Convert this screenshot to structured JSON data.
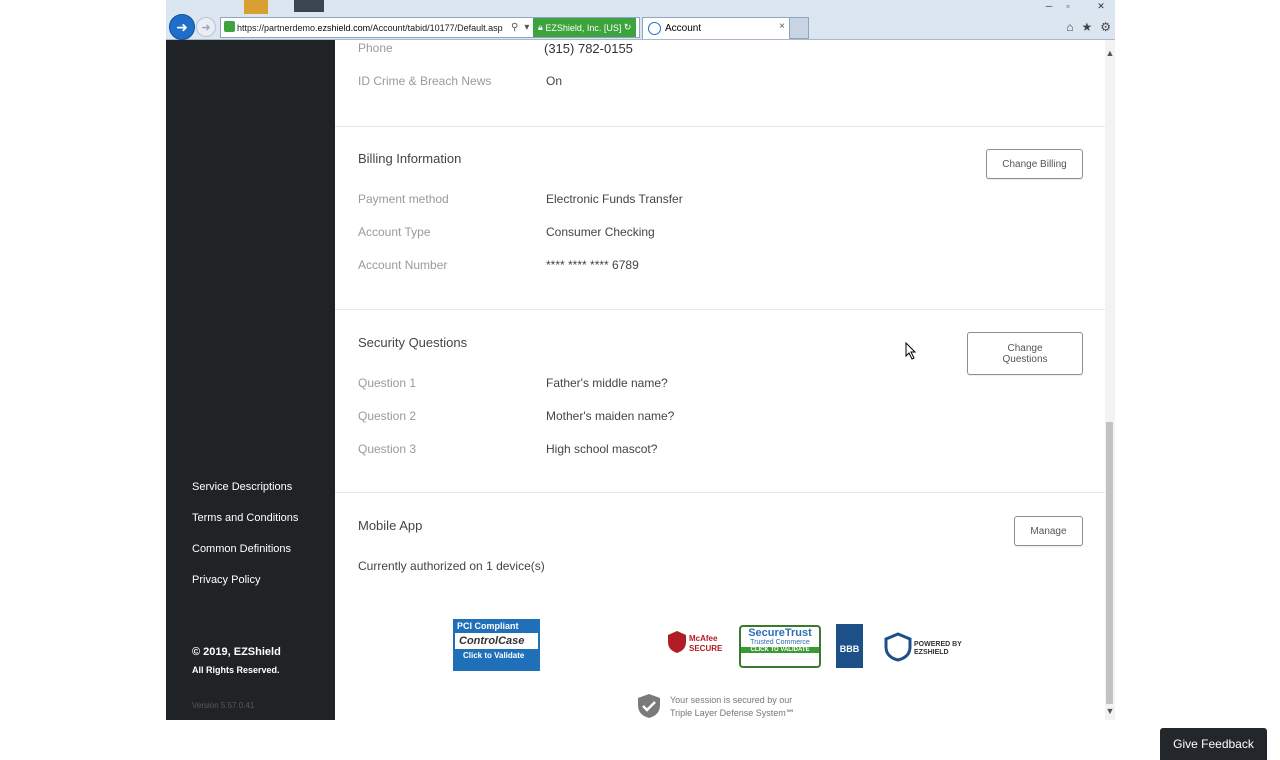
{
  "browser": {
    "url_prefix": "https://partnerdemo.",
    "url_domain": "ezshield.com",
    "url_path": "/Account/tabid/10177/Default.asp",
    "cert": "EZShield, Inc. [US]",
    "tab_title": "Account",
    "tab_close": "×"
  },
  "sidebar": {
    "links": [
      {
        "label": "Service Descriptions"
      },
      {
        "label": "Terms and Conditions"
      },
      {
        "label": "Common Definitions"
      },
      {
        "label": "Privacy Policy"
      }
    ],
    "copyright": "© 2019, EZShield",
    "rights": "All Rights Reserved.",
    "version": "Version 5.57.0.41"
  },
  "contact": {
    "phone_label": "Phone",
    "phone_value": "(315) 782-0155",
    "news_label": "ID Crime & Breach News",
    "news_value": "On"
  },
  "billing": {
    "title": "Billing Information",
    "button": "Change Billing",
    "rows": [
      {
        "label": "Payment method",
        "value": "Electronic Funds Transfer"
      },
      {
        "label": "Account Type",
        "value": "Consumer Checking"
      },
      {
        "label": "Account Number",
        "value": "**** **** **** 6789"
      }
    ]
  },
  "security": {
    "title": "Security Questions",
    "button_line1": "Change",
    "button_line2": "Questions",
    "rows": [
      {
        "label": "Question 1",
        "value": "Father's middle name?"
      },
      {
        "label": "Question 2",
        "value": "Mother's maiden name?"
      },
      {
        "label": "Question 3",
        "value": "High school mascot?"
      }
    ]
  },
  "mobile": {
    "title": "Mobile App",
    "button": "Manage",
    "status": "Currently authorized on 1 device(s)"
  },
  "badges": {
    "pci_top": "PCI Compliant",
    "pci_mid": "ControlCase",
    "pci_bot": "Click to Validate",
    "mcafee": "McAfee SECURE",
    "securetrust": "SecureTrust",
    "securetrust_sub": "Trusted Commerce",
    "securetrust_bar": "CLICK TO VALIDATE",
    "bbb": "BBB",
    "ezshield": "POWERED BY EZSHIELD"
  },
  "footer": {
    "session_line1": "Your session is secured by our",
    "session_line2": "Triple Layer Defense System℠",
    "feedback": "Give Feedback"
  }
}
